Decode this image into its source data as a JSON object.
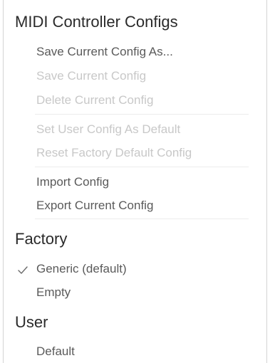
{
  "menu": {
    "title": "MIDI Controller Configs",
    "actions": {
      "save_as": "Save Current Config As...",
      "save": "Save Current Config",
      "delete": "Delete Current Config",
      "set_default": "Set User Config As Default",
      "reset_factory": "Reset Factory Default Config",
      "import": "Import Config",
      "export": "Export Current Config"
    },
    "factory": {
      "title": "Factory",
      "items": [
        "Generic (default)",
        "Empty"
      ],
      "selected": "Generic (default)"
    },
    "user": {
      "title": "User",
      "items": [
        "Default"
      ]
    }
  },
  "icons": {
    "selected_indicator": "checkmark-icon"
  },
  "colors": {
    "enabled_text": "#5a5a5a",
    "disabled_text": "#c8c8c8",
    "header_text": "#2a2a2a"
  }
}
